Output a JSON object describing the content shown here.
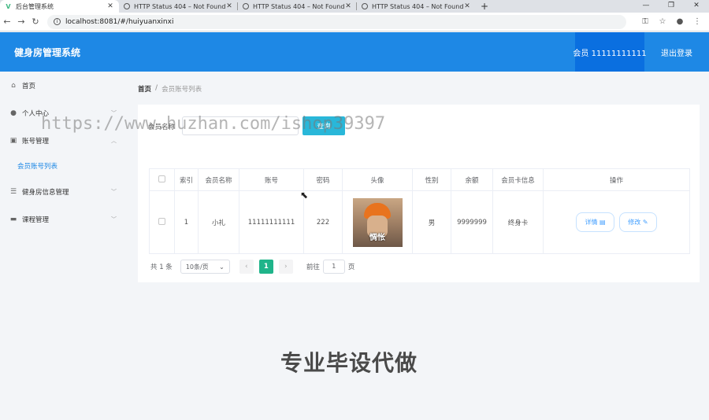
{
  "browser": {
    "tabs": [
      {
        "title": "后台管理系统",
        "active": true,
        "icon": "vue-icon"
      },
      {
        "title": "HTTP Status 404 – Not Found",
        "active": false,
        "icon": "globe-icon"
      },
      {
        "title": "HTTP Status 404 – Not Found",
        "active": false,
        "icon": "globe-icon"
      },
      {
        "title": "HTTP Status 404 – Not Found",
        "active": false,
        "icon": "globe-icon"
      }
    ],
    "url": "localhost:8081/#/huiyuanxinxi"
  },
  "header": {
    "title": "健身房管理系统",
    "member_label": "会员 11111111111",
    "logout_label": "退出登录",
    "color": "#1e88e5"
  },
  "sidebar": {
    "items": [
      {
        "label": "首页",
        "icon": "home-icon"
      },
      {
        "label": "个人中心",
        "icon": "user-icon"
      },
      {
        "label": "账号管理",
        "icon": "clipboard-icon",
        "sub": "会员账号列表"
      },
      {
        "label": "健身房信息管理",
        "icon": "list-icon"
      },
      {
        "label": "课程管理",
        "icon": "monitor-icon"
      }
    ]
  },
  "breadcrumb": {
    "home": "首页",
    "sep": "/",
    "current": "会员账号列表"
  },
  "search": {
    "label": "会员名称",
    "value": "",
    "button": "查询"
  },
  "table": {
    "columns": [
      "",
      "索引",
      "会员名称",
      "账号",
      "密码",
      "头像",
      "性别",
      "余额",
      "会员卡信息",
      "操作"
    ],
    "rows": [
      {
        "index": "1",
        "name": "小礼",
        "account": "11111111111",
        "password": "222",
        "avatar_caption": "惆怅",
        "gender": "男",
        "balance": "9999999",
        "card": "终身卡",
        "detail": "详情",
        "edit": "修改"
      }
    ]
  },
  "pager": {
    "total": "共 1 条",
    "size": "10条/页",
    "current": "1",
    "goto_prefix": "前往",
    "goto_value": "1",
    "goto_suffix": "页"
  },
  "overlay": {
    "watermark": "https://www.huzhan.com/ishop39397",
    "promo": "专业毕设代做"
  }
}
